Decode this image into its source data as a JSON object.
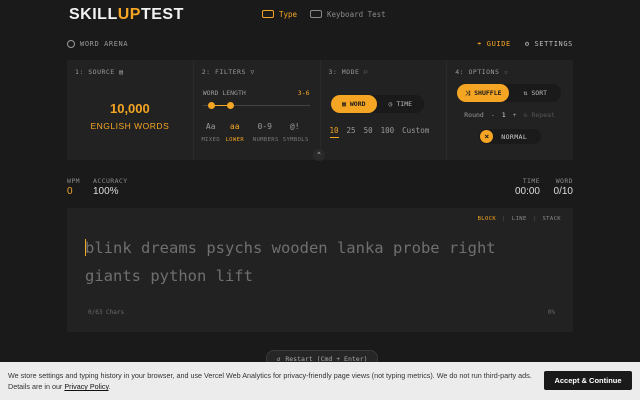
{
  "brand": {
    "pre": "SKILL",
    "accent": "UP",
    "post": "TEST"
  },
  "nav": {
    "type_label": "Type",
    "keyboard_label": "Keyboard Test"
  },
  "arena": {
    "title": "WORD ARENA",
    "guide_label": "GUIDE",
    "settings_label": "SETTINGS"
  },
  "source": {
    "title": "1: SOURCE",
    "count": "10,000",
    "label": "ENGLISH WORDS"
  },
  "filters": {
    "title": "2: FILTERS",
    "word_length_label": "WORD LENGTH",
    "word_length_range": "3-6",
    "items": [
      {
        "glyph": "Aa",
        "label": "MIXED"
      },
      {
        "glyph": "aa",
        "label": "LOWER"
      },
      {
        "glyph": "0-9",
        "label": "NUMBERS"
      },
      {
        "glyph": "@!",
        "label": "SYMBOLS"
      }
    ]
  },
  "mode": {
    "title": "3: MODE",
    "word_label": "WORD",
    "time_label": "TIME",
    "counts": [
      "10",
      "25",
      "50",
      "100",
      "Custom"
    ]
  },
  "options": {
    "title": "4: OPTIONS",
    "shuffle_label": "SHUFFLE",
    "sort_label": "SORT",
    "round_label": "Round",
    "round_minus": "-",
    "round_value": "1",
    "round_plus": "+",
    "repeat_label": "Repeat",
    "difficulty_label": "NORMAL"
  },
  "stats": {
    "wpm_label": "WPM",
    "wpm_value": "0",
    "accuracy_label": "ACCURACY",
    "accuracy_value": "100%",
    "time_label": "TIME",
    "time_value": "00:00",
    "word_label": "WORD",
    "word_value": "0/10"
  },
  "typing": {
    "views": [
      "BLOCK",
      "LINE",
      "STACK"
    ],
    "first_char": "b",
    "rest_line1": "link dreams psychs wooden lanka probe right",
    "line2": "giants python lift",
    "chars": "0/63 Chars",
    "progress": "0%"
  },
  "restart_label": "Restart (Cmd + Enter)",
  "cookie": {
    "text": "We store settings and typing history in your browser, and use Vercel Web Analytics for privacy-friendly page views (not typing metrics). We do not run third-party ads. Details are in our ",
    "link": "Privacy Policy",
    "end": ".",
    "accept_label": "Accept & Continue"
  },
  "colors": {
    "accent": "#f5a524",
    "background": "#1a1a1a",
    "panel": "#222222"
  }
}
